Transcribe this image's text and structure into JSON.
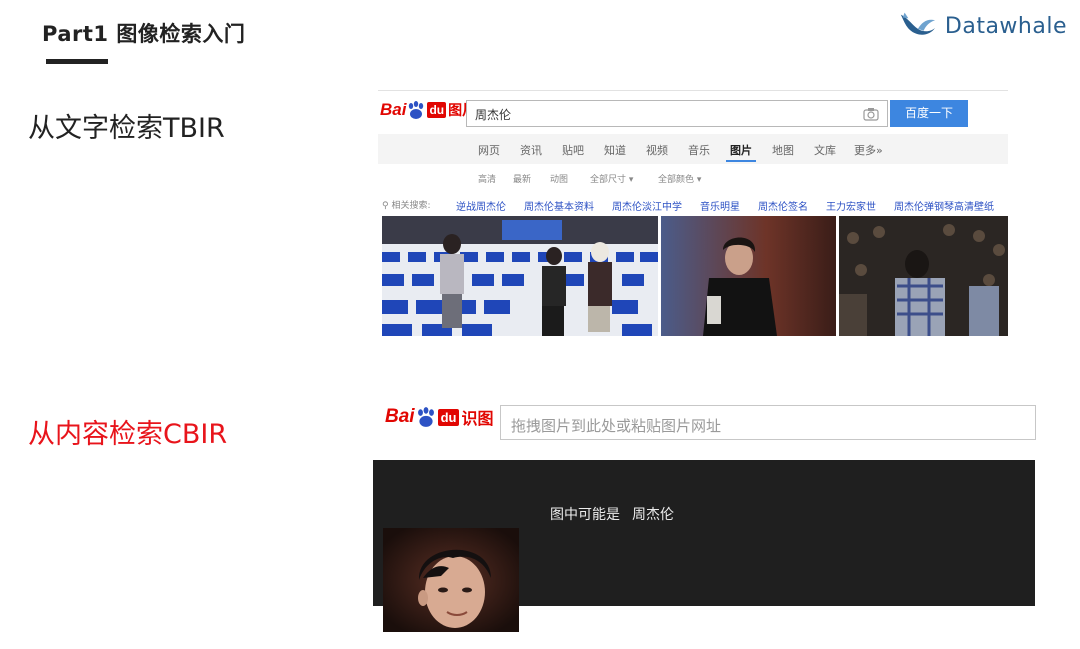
{
  "slide": {
    "title": "Part1  图像检索入门",
    "brand": "Datawhale",
    "label_tbir": "从文字检索TBIR",
    "label_cbir": "从内容检索CBIR"
  },
  "colors": {
    "baidu_red": "#e10602",
    "baidu_blue": "#3d86e0",
    "cbir_label": "#e8141b",
    "brand_blue": "#2a5f8f"
  },
  "tbir": {
    "logo_text": "Bai",
    "logo_badge": "du",
    "logo_suffix": "图片",
    "query": "周杰伦",
    "camera_icon": "camera-icon",
    "search_button": "百度一下",
    "nav": [
      "网页",
      "资讯",
      "贴吧",
      "知道",
      "视频",
      "音乐",
      "图片",
      "地图",
      "文库",
      "更多»"
    ],
    "nav_active": "图片",
    "filters": [
      "高清",
      "最新",
      "动图",
      "全部尺寸 ▾",
      "全部颜色 ▾"
    ],
    "related_label": "相关搜索:",
    "related": [
      "逆战周杰伦",
      "周杰伦基本资料",
      "周杰伦淡江中学",
      "音乐明星",
      "周杰伦签名",
      "王力宏家世",
      "周杰伦弹钢琴高清壁纸"
    ]
  },
  "cbir": {
    "logo_text": "Bai",
    "logo_badge": "du",
    "logo_suffix": "识图",
    "input_placeholder": "拖拽图片到此处或粘贴图片网址",
    "result_prefix": "图中可能是",
    "result_name": "周杰伦"
  }
}
